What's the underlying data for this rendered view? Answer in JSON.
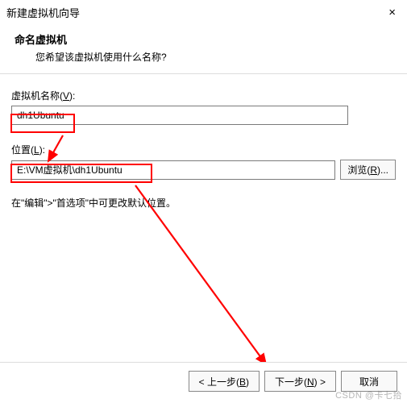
{
  "titlebar": {
    "title": "新建虚拟机向导",
    "close": "×"
  },
  "header": {
    "title": "命名虚拟机",
    "subtitle": "您希望该虚拟机使用什么名称?"
  },
  "fields": {
    "name_label_pre": "虚拟机名称(",
    "name_label_key": "V",
    "name_label_post": "):",
    "name_value": "dh1Ubuntu",
    "location_label_pre": "位置(",
    "location_label_key": "L",
    "location_label_post": "):",
    "location_value": "E:\\VM虚拟机\\dh1Ubuntu",
    "browse_pre": "浏览(",
    "browse_key": "R",
    "browse_post": ")..."
  },
  "hint": "在\"编辑\">\"首选项\"中可更改默认位置。",
  "footer": {
    "back_pre": "< 上一步(",
    "back_key": "B",
    "back_post": ")",
    "next_pre": "下一步(",
    "next_key": "N",
    "next_post": ") >",
    "cancel": "取消"
  },
  "watermark": "CSDN @卡七拾"
}
